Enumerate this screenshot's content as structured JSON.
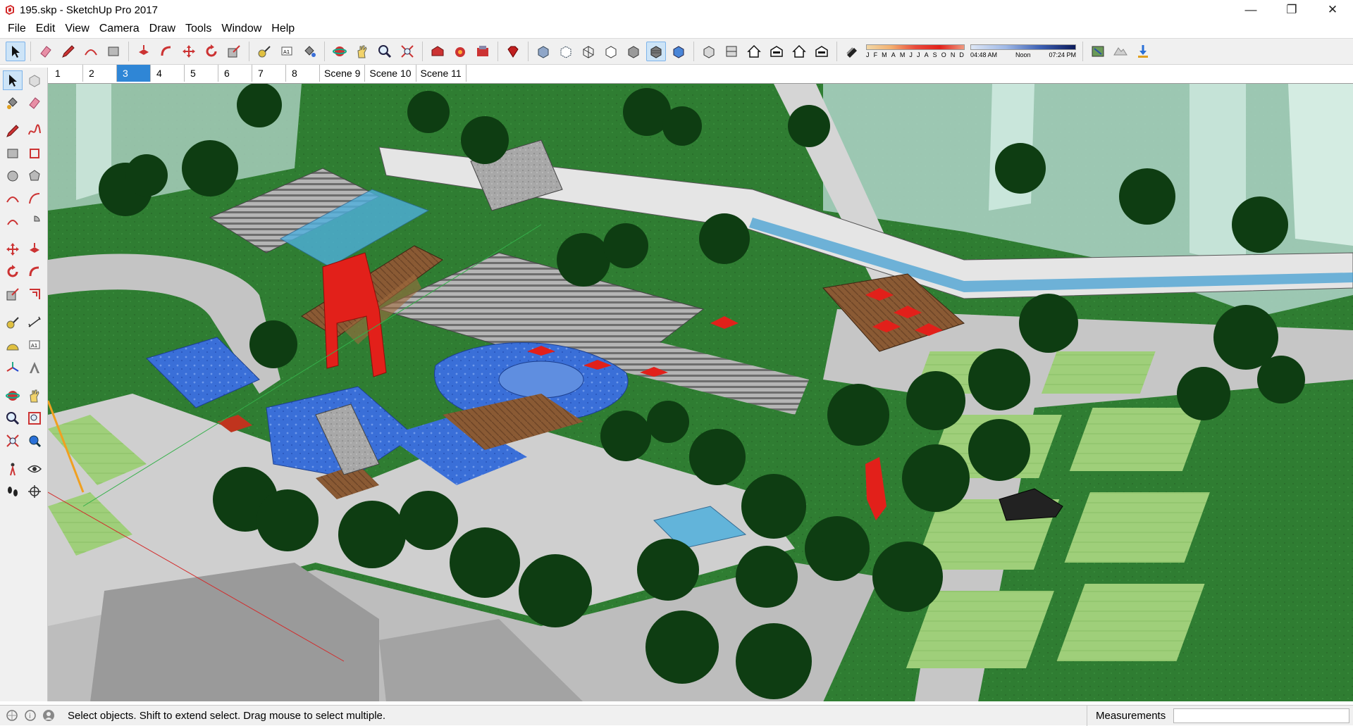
{
  "window": {
    "title": "195.skp - SketchUp Pro 2017",
    "minimize": "—",
    "maximize": "❐",
    "close": "✕"
  },
  "menu": [
    "File",
    "Edit",
    "View",
    "Camera",
    "Draw",
    "Tools",
    "Window",
    "Help"
  ],
  "shadow": {
    "months": [
      "J",
      "F",
      "M",
      "A",
      "M",
      "J",
      "J",
      "A",
      "S",
      "O",
      "N",
      "D"
    ],
    "time_start": "04:48 AM",
    "time_mid": "Noon",
    "time_end": "07:24 PM"
  },
  "scenes": [
    "1",
    "2",
    "3",
    "4",
    "5",
    "6",
    "7",
    "8",
    "Scene 9",
    "Scene 10",
    "Scene 11"
  ],
  "active_scene_index": 2,
  "status": {
    "message": "Select objects. Shift to extend select. Drag mouse to select multiple.",
    "measurements_label": "Measurements",
    "measurements_value": ""
  },
  "colors": {
    "accent": "#2f86d6",
    "grass": "#2f7d32",
    "paving": "#c9c9c9",
    "water": "#3a6fd8",
    "red": "#e2201a"
  }
}
